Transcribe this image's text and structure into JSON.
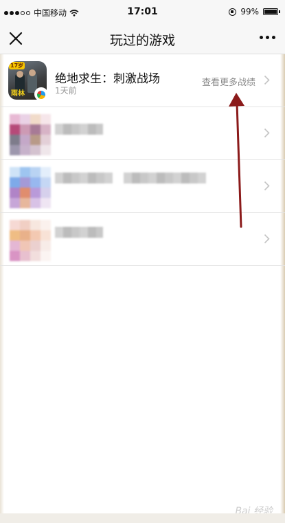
{
  "status_bar": {
    "carrier": "中国移动",
    "time": "17:01",
    "battery": "99%"
  },
  "nav": {
    "title": "玩过的游戏",
    "close_icon": "close-icon",
    "more_icon": "more-icon"
  },
  "games": [
    {
      "title": "绝地求生：刺激战场",
      "subtitle": "1天前",
      "action": "查看更多战绩",
      "icon_tag": "17岁",
      "icon_text": "雨林"
    },
    {
      "title": "",
      "subtitle": "",
      "action": ""
    },
    {
      "title": "",
      "subtitle": "",
      "action": ""
    },
    {
      "title": "",
      "subtitle": "",
      "action": ""
    }
  ],
  "watermark": "Bai 经验",
  "colors": {
    "annotation_arrow": "#8b1a1a",
    "navbar_bg": "#f7f7f7",
    "secondary_text": "#999999"
  }
}
